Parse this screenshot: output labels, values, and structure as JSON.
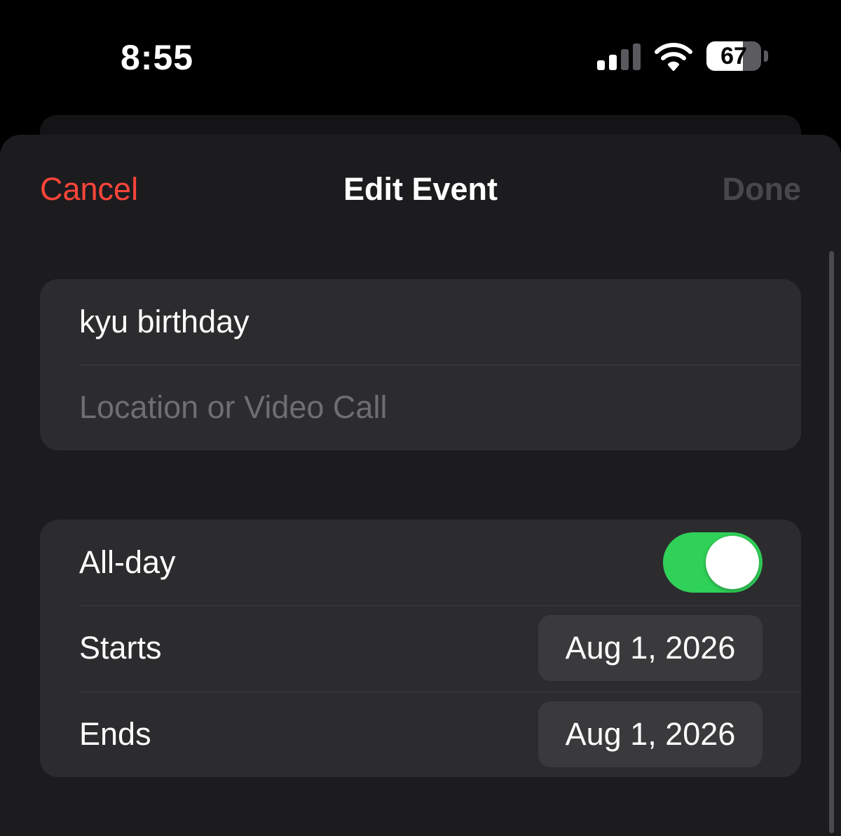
{
  "status_bar": {
    "time": "8:55",
    "battery_level": "67",
    "battery_fraction": 0.67,
    "signal_bars_active": 2,
    "signal_bars_total": 4,
    "icons": [
      "signal-icon",
      "wifi-icon",
      "battery-icon"
    ]
  },
  "nav": {
    "cancel_label": "Cancel",
    "title": "Edit Event",
    "done_label": "Done"
  },
  "details": {
    "title_value": "kyu birthday",
    "location_placeholder": "Location or Video Call"
  },
  "timing": {
    "all_day_label": "All-day",
    "all_day_on": true,
    "starts_label": "Starts",
    "starts_value": "Aug 1, 2026",
    "ends_label": "Ends",
    "ends_value": "Aug 1, 2026"
  },
  "colors": {
    "accent_red": "#ff453a",
    "toggle_green": "#30d158",
    "card_background": "#2c2c2e",
    "sheet_background": "#1c1c1e",
    "done_disabled": "#48484a"
  }
}
